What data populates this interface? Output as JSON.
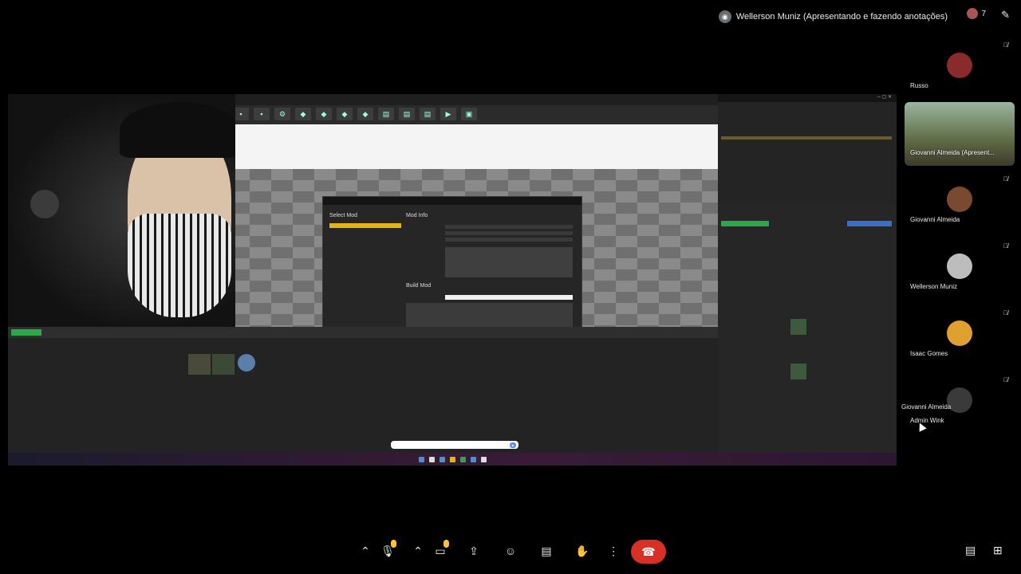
{
  "presenter": {
    "label": "Wellerson Muniz (Apresentando e fazendo anotações)",
    "count": "7"
  },
  "screen_share": {
    "modal": {
      "select_mod": "Select Mod",
      "mod_info": "Mod Info",
      "build_mod": "Build Mod"
    }
  },
  "participants": [
    {
      "name": "Russo",
      "muted": true,
      "avatar_color": "#8a2a2a"
    },
    {
      "name": "Giovanni Almeida (Apresent...",
      "muted": false,
      "video": true
    },
    {
      "name": "Giovanni Almeida",
      "muted": true,
      "avatar_color": "#7a4a30"
    },
    {
      "name": "Wellerson Muniz",
      "muted": true,
      "avatar_color": "#bdbdbd"
    },
    {
      "name": "Isaac Gomes",
      "muted": true,
      "avatar_color": "#e0a030"
    },
    {
      "name": "Admin Wink",
      "muted": true,
      "avatar_color": "#3a3a3a"
    }
  ],
  "tooltip": "Giovanni Almeida",
  "icons": {
    "mic": "mic-icon",
    "camera": "camera-icon",
    "present": "present-icon",
    "emoji": "emoji-icon",
    "captions": "captions-icon",
    "hand": "raise-hand-icon",
    "more": "more-options-icon",
    "hangup": "hangup-icon",
    "chat": "chat-icon",
    "activities": "activities-icon"
  },
  "colors": {
    "hangup": "#d93025",
    "mic_badge": "#f9c536",
    "highlight": "#e3b31c"
  }
}
